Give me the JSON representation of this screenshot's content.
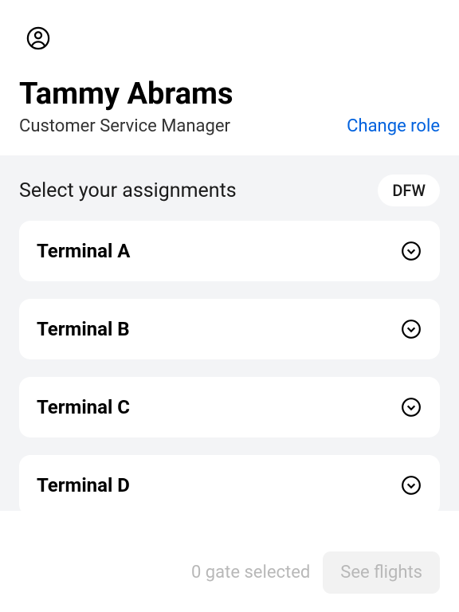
{
  "header": {
    "user_name": "Tammy Abrams",
    "role_label": "Customer Service Manager",
    "change_role_label": "Change role"
  },
  "assignments": {
    "title": "Select your assignments",
    "location": "DFW",
    "terminals": [
      {
        "label": "Terminal A"
      },
      {
        "label": "Terminal B"
      },
      {
        "label": "Terminal C"
      },
      {
        "label": "Terminal D"
      }
    ]
  },
  "footer": {
    "gate_status": "0 gate selected",
    "see_flights_label": "See flights"
  }
}
